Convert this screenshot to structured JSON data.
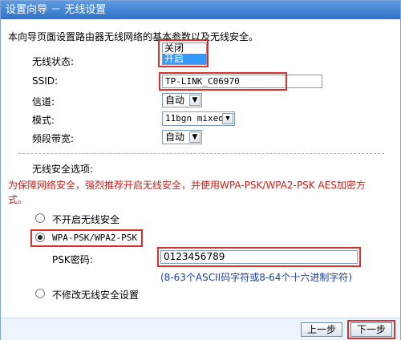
{
  "window": {
    "title": "设置向导 － 无线设置"
  },
  "intro": "本向导页面设置路由器无线网络的基本参数以及无线安全。",
  "wireless_status": {
    "label": "无线状态:",
    "options": [
      "关闭",
      "开启"
    ],
    "selected": "开启"
  },
  "ssid": {
    "label": "SSID:",
    "value": "TP-LINK_C06970"
  },
  "channel": {
    "label": "信道:",
    "value": "自动"
  },
  "mode": {
    "label": "模式:",
    "value": "11bgn mixed"
  },
  "bandwidth": {
    "label": "频段带宽:",
    "value": "自动"
  },
  "security": {
    "heading": "无线安全选项:",
    "warning_line1": "为保障网络安全，强烈推荐开启无线安全，并使用WPA-PSK/WPA2-PSK AES加密方",
    "warning_line2": "式。",
    "opt_disable": "不开启无线安全",
    "opt_wpa": "WPA-PSK/WPA2-PSK",
    "psk_label": "PSK密码:",
    "psk_value": "0123456789",
    "psk_hint": "(8-63个ASCII码字符或8-64个十六进制字符)",
    "opt_keep": "不修改无线安全设置",
    "selected": "WPA-PSK/WPA2-PSK"
  },
  "buttons": {
    "prev": "上一步",
    "next": "下一步"
  },
  "colors": {
    "title_bar": "#3b7fd4",
    "highlight_box": "#d9302c",
    "warning_text": "#d0201c",
    "hint_text": "#1b3fa8"
  }
}
